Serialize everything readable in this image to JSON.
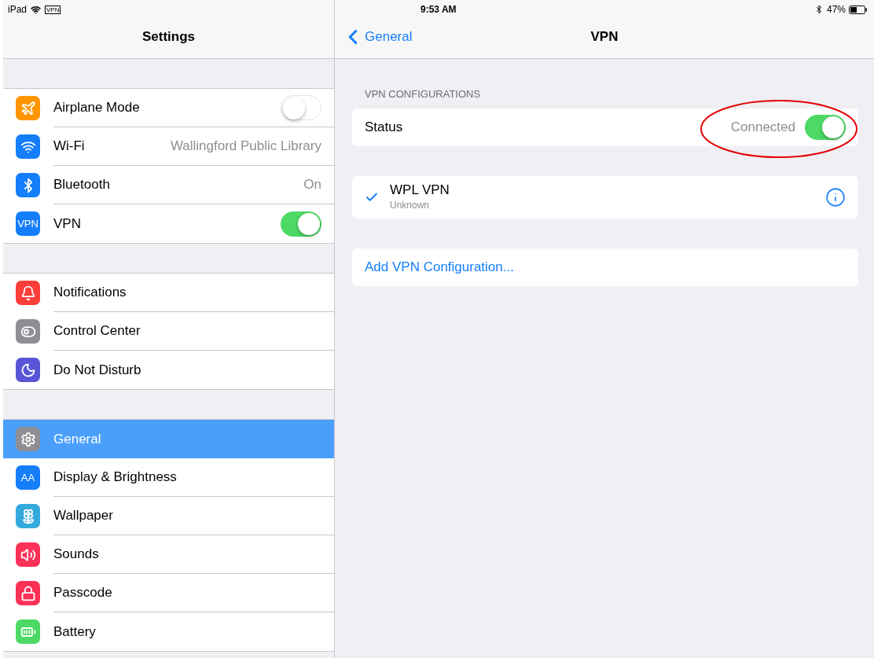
{
  "status_bar": {
    "device": "iPad",
    "vpn_badge": "VPN",
    "time": "9:53 AM",
    "battery_percent": "47%"
  },
  "sidebar": {
    "title": "Settings",
    "groups": [
      {
        "items": [
          {
            "kind": "toggle",
            "label": "Airplane Mode",
            "color": "#ff9500",
            "on": false,
            "selected": false
          },
          {
            "kind": "value",
            "label": "Wi-Fi",
            "color": "#147efb",
            "value": "Wallingford Public Library",
            "selected": false
          },
          {
            "kind": "value",
            "label": "Bluetooth",
            "color": "#147efb",
            "value": "On",
            "selected": false
          },
          {
            "kind": "toggle",
            "label": "VPN",
            "color": "#147efb",
            "icon_text": "VPN",
            "on": true,
            "selected": false
          }
        ]
      },
      {
        "items": [
          {
            "kind": "plain",
            "label": "Notifications",
            "color": "#fc3d39",
            "selected": false
          },
          {
            "kind": "plain",
            "label": "Control Center",
            "color": "#8e8e93",
            "selected": false
          },
          {
            "kind": "plain",
            "label": "Do Not Disturb",
            "color": "#5856d6",
            "selected": false
          }
        ]
      },
      {
        "items": [
          {
            "kind": "plain",
            "label": "General",
            "color": "#8e8e93",
            "selected": true
          },
          {
            "kind": "plain",
            "label": "Display & Brightness",
            "color": "#147efb",
            "icon_text": "AA",
            "selected": false
          },
          {
            "kind": "plain",
            "label": "Wallpaper",
            "color": "#34aadc",
            "selected": false
          },
          {
            "kind": "plain",
            "label": "Sounds",
            "color": "#fc3158",
            "selected": false
          },
          {
            "kind": "plain",
            "label": "Passcode",
            "color": "#fc3158",
            "selected": false
          },
          {
            "kind": "plain",
            "label": "Battery",
            "color": "#4cd964",
            "selected": false
          }
        ]
      }
    ]
  },
  "detail": {
    "back": "General",
    "title": "VPN",
    "section_header": "VPN CONFIGURATIONS",
    "status": {
      "label": "Status",
      "value": "Connected",
      "on": true,
      "highlighted": true
    },
    "configurations": [
      {
        "name": "WPL VPN",
        "subtitle": "Unknown",
        "checked": true
      }
    ],
    "add_link": "Add VPN Configuration..."
  }
}
